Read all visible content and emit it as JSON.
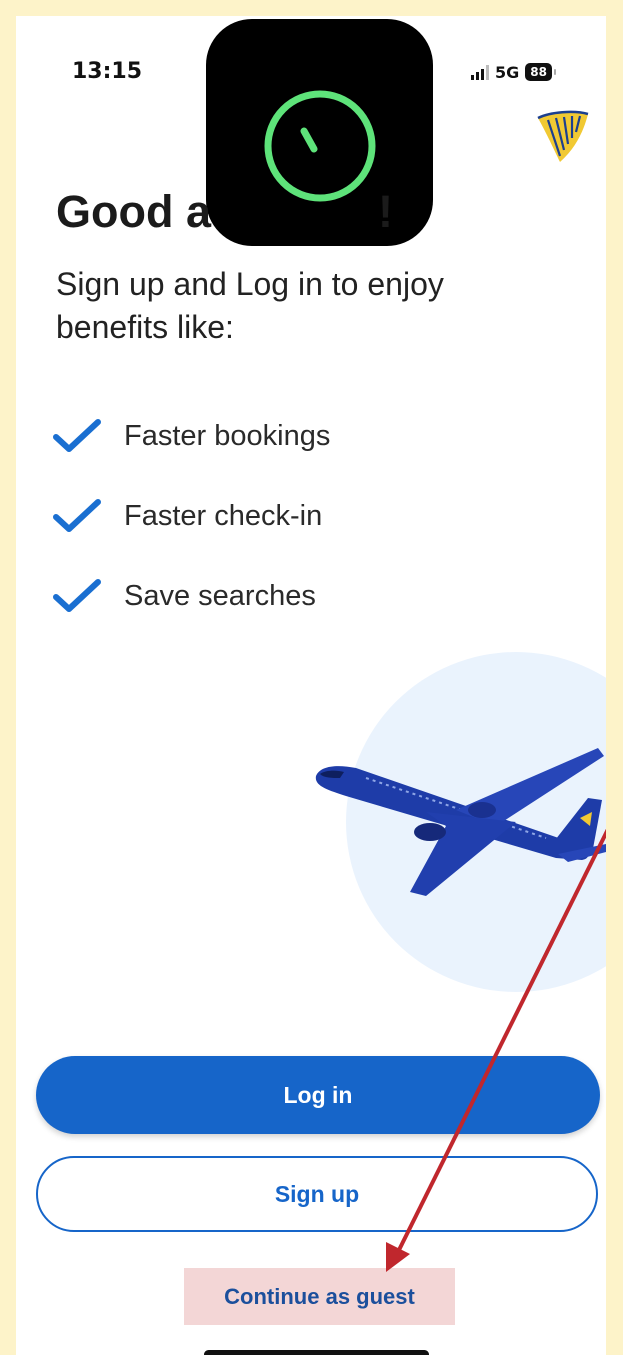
{
  "status_bar": {
    "time": "13:15",
    "network": "5G",
    "battery": "88"
  },
  "brand": {
    "logo_icon": "harp-logo-icon",
    "logo_color": "#f1c933"
  },
  "header": {
    "greeting": "Good a",
    "greeting_end": "!",
    "subtitle": "Sign up and Log in to enjoy benefits like:"
  },
  "benefits": [
    {
      "label": "Faster bookings",
      "icon": "checkmark-icon"
    },
    {
      "label": "Faster check-in",
      "icon": "checkmark-icon"
    },
    {
      "label": "Save searches",
      "icon": "checkmark-icon"
    }
  ],
  "actions": {
    "login_label": "Log in",
    "signup_label": "Sign up",
    "guest_label": "Continue as guest"
  },
  "colors": {
    "primary": "#1665c9",
    "check": "#1a6fd1",
    "annotation_arrow": "#c0272d",
    "guest_highlight": "#f3d6d6"
  }
}
